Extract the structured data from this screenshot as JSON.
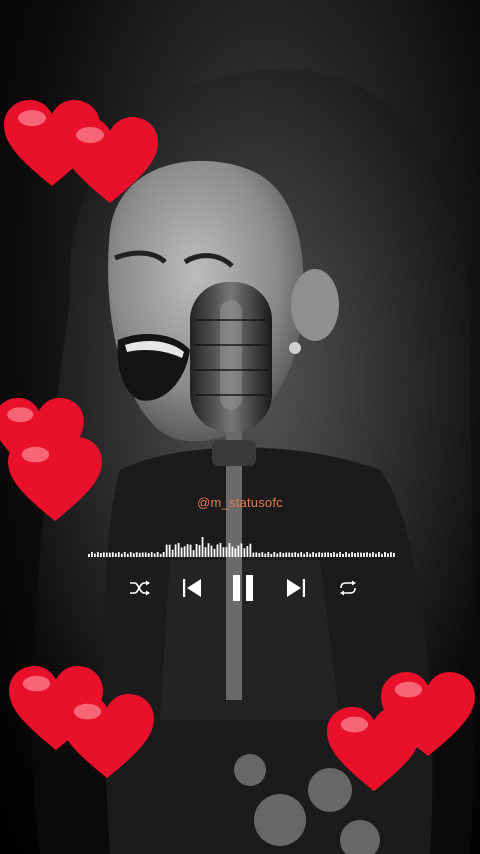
{
  "overlay": {
    "handle": "@m_statusofc"
  },
  "player": {
    "controls": [
      {
        "name": "shuffle-button",
        "icon": "shuffle-icon"
      },
      {
        "name": "previous-button",
        "icon": "skip-previous-icon"
      },
      {
        "name": "pause-button",
        "icon": "pause-icon"
      },
      {
        "name": "next-button",
        "icon": "skip-next-icon"
      },
      {
        "name": "repeat-button",
        "icon": "repeat-icon"
      }
    ]
  },
  "colors": {
    "handle_text": "#e07a52",
    "waveform": "#ffffff",
    "controls": "#ffffff",
    "heart": "#e8102a"
  },
  "decorations": {
    "hearts_count": 8,
    "heart_icon": "heart-icon"
  }
}
